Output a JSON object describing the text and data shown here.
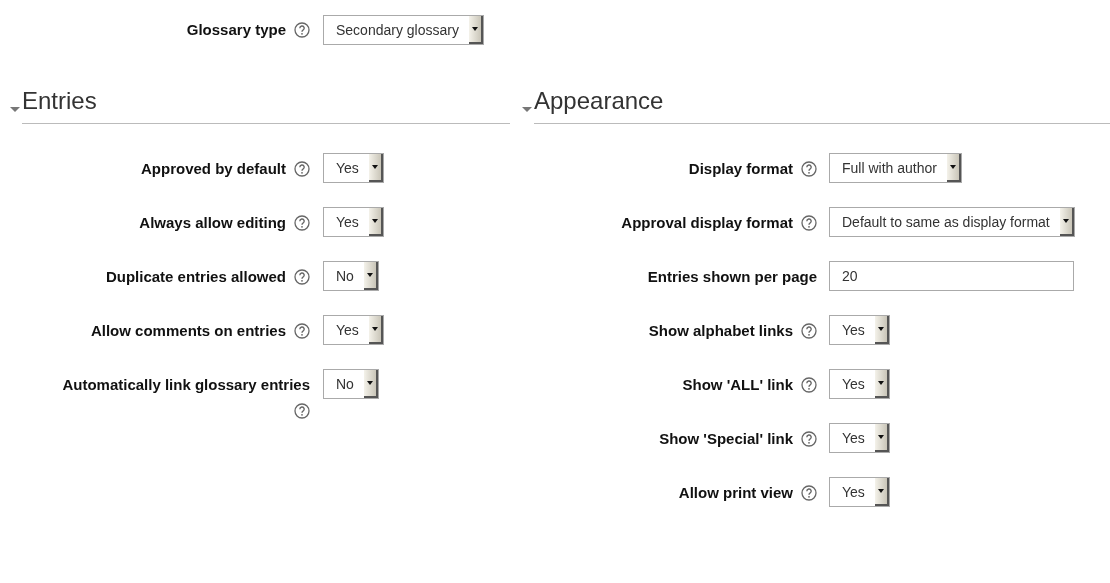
{
  "glossary_type": {
    "label": "Glossary type",
    "help": true,
    "kind": "select",
    "value": "Secondary glossary"
  },
  "sections": [
    {
      "title": "Entries",
      "expanded": true,
      "fields": [
        {
          "label": "Approved by default",
          "help": true,
          "kind": "select",
          "value": "Yes"
        },
        {
          "label": "Always allow editing",
          "help": true,
          "kind": "select",
          "value": "Yes"
        },
        {
          "label": "Duplicate entries allowed",
          "help": true,
          "kind": "select",
          "value": "No"
        },
        {
          "label": "Allow comments on entries",
          "help": true,
          "kind": "select",
          "value": "Yes"
        },
        {
          "label": "Automatically link glossary entries",
          "help": true,
          "kind": "select",
          "value": "No"
        }
      ]
    },
    {
      "title": "Appearance",
      "expanded": true,
      "fields": [
        {
          "label": "Display format",
          "help": true,
          "kind": "select",
          "value": "Full with author"
        },
        {
          "label": "Approval display format",
          "help": true,
          "kind": "select",
          "value": "Default to same as display format"
        },
        {
          "label": "Entries shown per page",
          "help": false,
          "kind": "text",
          "value": "20"
        },
        {
          "label": "Show alphabet links",
          "help": true,
          "kind": "select",
          "value": "Yes"
        },
        {
          "label": "Show 'ALL' link",
          "help": true,
          "kind": "select",
          "value": "Yes"
        },
        {
          "label": "Show 'Special' link",
          "help": true,
          "kind": "select",
          "value": "Yes"
        },
        {
          "label": "Allow print view",
          "help": true,
          "kind": "select",
          "value": "Yes"
        }
      ]
    }
  ]
}
